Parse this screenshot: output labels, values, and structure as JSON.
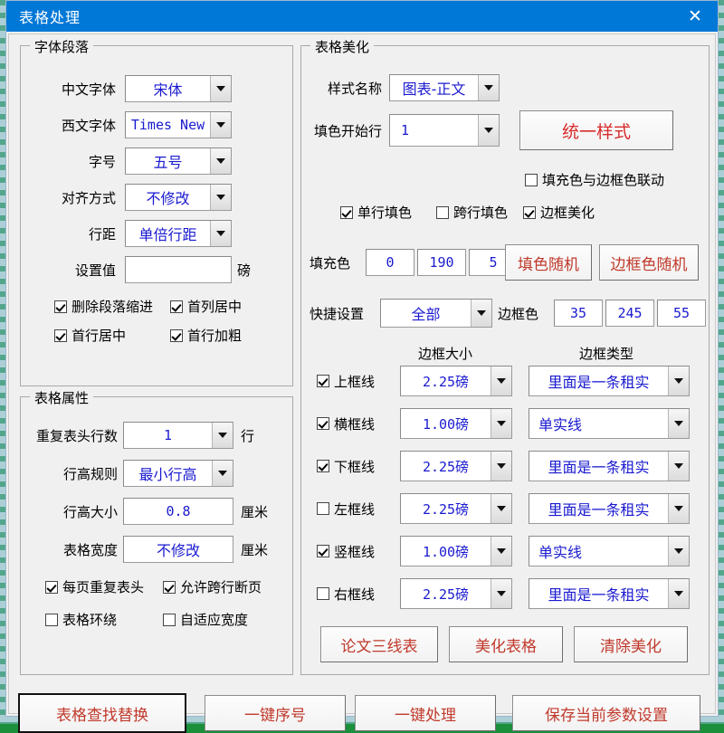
{
  "window": {
    "title": "表格处理",
    "close_label": "✕",
    "titlebar_color": "#0078d7"
  },
  "font_paragraph": {
    "legend": "字体段落",
    "fields": [
      {
        "label": "中文字体",
        "value": "宋体"
      },
      {
        "label": "西文字体",
        "value": "Times New"
      },
      {
        "label": "字号",
        "value": "五号"
      },
      {
        "label": "对齐方式",
        "value": "不修改"
      },
      {
        "label": "行距",
        "value": "单倍行距"
      }
    ],
    "set_value": {
      "label": "设置值",
      "value": "",
      "unit": "磅"
    },
    "checkboxes": [
      {
        "label": "删除段落缩进",
        "checked": true
      },
      {
        "label": "首列居中",
        "checked": true
      },
      {
        "label": "首行居中",
        "checked": true
      },
      {
        "label": "首行加粗",
        "checked": true
      }
    ]
  },
  "table_properties": {
    "legend": "表格属性",
    "header_rows": {
      "label": "重复表头行数",
      "value": "1",
      "unit": "行"
    },
    "row_height_rule": {
      "label": "行高规则",
      "value": "最小行高"
    },
    "row_height_size": {
      "label": "行高大小",
      "value": "0.8",
      "unit": "厘米"
    },
    "table_width": {
      "label": "表格宽度",
      "value": "不修改",
      "unit": "厘米"
    },
    "checkboxes": [
      {
        "label": "每页重复表头",
        "checked": true
      },
      {
        "label": "允许跨行断页",
        "checked": true
      },
      {
        "label": "表格环绕",
        "checked": false
      },
      {
        "label": "自适应宽度",
        "checked": false
      }
    ]
  },
  "table_beautify": {
    "legend": "表格美化",
    "style_name": {
      "label": "样式名称",
      "value": "图表-正文"
    },
    "unify_style_button": "统一样式",
    "fill_start_row": {
      "label": "填色开始行",
      "value": "1"
    },
    "link_fill_border": {
      "label": "填充色与边框色联动",
      "checked": false
    },
    "checkboxes": [
      {
        "label": "单行填色",
        "checked": true
      },
      {
        "label": "跨行填色",
        "checked": false
      },
      {
        "label": "边框美化",
        "checked": true
      }
    ],
    "fill_color": {
      "label": "填充色",
      "r": "0",
      "g": "190",
      "b": "5"
    },
    "fill_random_button": "填色随机",
    "border_random_button": "边框色随机",
    "quick_setting": {
      "label": "快捷设置",
      "value": "全部"
    },
    "border_color": {
      "label": "边框色",
      "r": "35",
      "g": "245",
      "b": "55"
    },
    "col_headers": {
      "size": "边框大小",
      "type": "边框类型"
    },
    "border_rows": [
      {
        "label": "上框线",
        "checked": true,
        "size": "2.25磅",
        "type": "里面是一条租实"
      },
      {
        "label": "横框线",
        "checked": true,
        "size": "1.00磅",
        "type": "单实线"
      },
      {
        "label": "下框线",
        "checked": true,
        "size": "2.25磅",
        "type": "里面是一条租实"
      },
      {
        "label": "左框线",
        "checked": false,
        "size": "2.25磅",
        "type": "里面是一条租实"
      },
      {
        "label": "竖框线",
        "checked": true,
        "size": "1.00磅",
        "type": "单实线"
      },
      {
        "label": "右框线",
        "checked": false,
        "size": "2.25磅",
        "type": "里面是一条租实"
      }
    ],
    "actions": [
      "论文三线表",
      "美化表格",
      "清除美化"
    ]
  },
  "footer": {
    "buttons": [
      {
        "label": "表格查找替换",
        "focused": true
      },
      {
        "label": "一键序号",
        "focused": false
      },
      {
        "label": "一键处理",
        "focused": false
      },
      {
        "label": "保存当前参数设置",
        "focused": false
      }
    ]
  }
}
